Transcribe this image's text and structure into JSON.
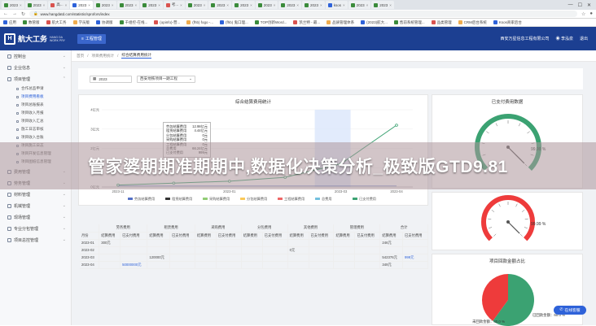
{
  "browser": {
    "tabs": [
      {
        "label": "2023",
        "color": "#3b8b3b",
        "active": false
      },
      {
        "label": "2023",
        "color": "#3b8b3b",
        "active": false
      },
      {
        "label": "高...",
        "color": "#d9534f",
        "active": false
      },
      {
        "label": "2023",
        "color": "#2e62d9",
        "active": true
      },
      {
        "label": "2023",
        "color": "#3b8b3b",
        "active": false
      },
      {
        "label": "2023",
        "color": "#3b8b3b",
        "active": false
      },
      {
        "label": "2023",
        "color": "#3b8b3b",
        "active": false
      },
      {
        "label": "考...",
        "color": "#d9534f",
        "active": false
      },
      {
        "label": "2023",
        "color": "#3b8b3b",
        "active": false
      },
      {
        "label": "2023",
        "color": "#3b8b3b",
        "active": false
      },
      {
        "label": "2023",
        "color": "#3b8b3b",
        "active": false
      },
      {
        "label": "2023",
        "color": "#3b8b3b",
        "active": false
      },
      {
        "label": "2023",
        "color": "#3b8b3b",
        "active": false
      },
      {
        "label": "2023",
        "color": "#3b8b3b",
        "active": false
      },
      {
        "label": "ksos",
        "color": "#2e62d9",
        "active": false
      },
      {
        "label": "2023",
        "color": "#3b8b3b",
        "active": false
      },
      {
        "label": "2023",
        "color": "#3b8b3b",
        "active": false
      }
    ],
    "url": "www.hangdatd.com/statistic/sprofors/index",
    "bookmarks": [
      "应用",
      "数管版",
      "航大工务",
      "学员版",
      "协调版",
      "千组控-在线...",
      "(opinfo)-营...",
      "(fhb) fogo -...",
      "(fhb) 鬼口理...",
      "TOP创新Word...",
      "凯兰特 - 最...",
      "品质管理体系",
      "(2023)航大...",
      "售前系统管理...",
      "品类管理",
      "CRM后台系统",
      "Ksos商家后台"
    ]
  },
  "app": {
    "logo_text": "航大工务",
    "logo_sub_1": "HANG DA",
    "logo_sub_2": "WORK PRY",
    "menu_label": "工程管理",
    "company": "西安万星信息工程有限公司",
    "user": "李泓泉",
    "logout": "退出"
  },
  "sidebar": {
    "items": [
      {
        "label": "控制台"
      },
      {
        "label": "企业信息"
      },
      {
        "label": "项目管理"
      }
    ],
    "subitems": [
      {
        "label": "合作总监申请",
        "active": false
      },
      {
        "label": "项目费用看板",
        "active": true
      },
      {
        "label": "项目总账报表",
        "active": false
      },
      {
        "label": "项目收入月报",
        "active": false
      },
      {
        "label": "项目收入汇总",
        "active": false
      },
      {
        "label": "施工日志审核",
        "active": false
      },
      {
        "label": "项目收入台账",
        "active": false
      },
      {
        "label": "项目施工日志",
        "active": false
      },
      {
        "label": "项目开发信息管理",
        "active": false
      },
      {
        "label": "项目图纸信息管理",
        "active": false
      }
    ],
    "bottom_items": [
      {
        "label": "费用管理"
      },
      {
        "label": "劳务管理"
      },
      {
        "label": "材料管理"
      },
      {
        "label": "机械管理"
      },
      {
        "label": "现场管理"
      },
      {
        "label": "专业分包管理"
      },
      {
        "label": "项目总控管理"
      }
    ]
  },
  "breadcrumb": [
    "首页",
    "项目费用统计",
    "综合结算费用统计"
  ],
  "filter": {
    "year": "2023",
    "project_placeholder": "西安地铁项目一期工程"
  },
  "line_chart": {
    "title": "综合结算费用统计",
    "y_ticks": [
      "4亿元",
      "3亿元",
      "2亿元",
      "1亿元",
      "0亿元"
    ],
    "legend": [
      "劳务结算费用",
      "租赁结算费用",
      "采购结算费用",
      "分包结算费用",
      "工程结算费用",
      "总费用",
      "已支付费用"
    ],
    "legend_colors": [
      "#5470c6",
      "#333333",
      "#91cc75",
      "#fac858",
      "#ee6666",
      "#73c0de",
      "#3ba272"
    ],
    "chart_data": {
      "type": "line",
      "x": [
        "2023-11",
        "2023-12",
        "2023-01",
        "2023-02",
        "2023-03",
        "2023-04"
      ],
      "series": [
        {
          "name": "总费用",
          "values": [
            0.1,
            0.2,
            0.3,
            0.5,
            1.2,
            3.2
          ]
        }
      ],
      "ylim": [
        0,
        4
      ]
    }
  },
  "tooltip": {
    "rows": [
      {
        "label": "劳务结算费用",
        "value": "12.98亿元"
      },
      {
        "label": "租赁结算费用",
        "value": "4.44亿元"
      },
      {
        "label": "分包结算费用",
        "value": "0元"
      },
      {
        "label": "采购结算费用",
        "value": "0元"
      },
      {
        "label": "工程结算费用",
        "value": "0元"
      },
      {
        "label": "总费用",
        "value": "66.24亿元"
      },
      {
        "label": "已支付费用",
        "value": "999元"
      }
    ]
  },
  "table": {
    "group_headers": [
      "",
      "劳务费用",
      "租赁费用",
      "采购费用",
      "分包费用",
      "其他费用",
      "管理费用",
      "合计"
    ],
    "sub_headers": [
      "月份",
      "结算费用",
      "已支付费用",
      "结算费用",
      "已支付费用",
      "结算费用",
      "已支付费用",
      "结算费用",
      "已支付费用",
      "结算费用",
      "已支付费用",
      "结算费用",
      "已支付费用",
      "结算费用",
      "已支付费用"
    ],
    "rows": [
      [
        "2023-01",
        "300元",
        "",
        "",
        "",
        "",
        "",
        "",
        "",
        "",
        "",
        "",
        "",
        "246元",
        ""
      ],
      [
        "2023-02",
        "",
        "",
        "",
        "",
        "",
        "",
        "",
        "",
        "0元",
        "",
        "",
        "",
        "",
        ""
      ],
      [
        "2023-03",
        "",
        "",
        "120000元",
        "",
        "",
        "",
        "",
        "",
        "",
        "",
        "",
        "",
        "542376元",
        "999元"
      ],
      [
        "2023-04",
        "",
        "50000000元",
        "",
        "",
        "",
        "",
        "",
        "",
        "",
        "",
        "",
        "",
        "349元",
        ""
      ]
    ]
  },
  "gauges": [
    {
      "title": "已支付费用数据",
      "value_label": "99.99 %",
      "value": 99.99,
      "color": "#3ba272"
    },
    {
      "title": "已支付费用数据",
      "value_label": "99.99 %",
      "value": 99.99,
      "color": "#ee3b3b"
    }
  ],
  "pie": {
    "title": "项目回款金额占比",
    "chart_data": {
      "type": "pie",
      "labels": [
        "已回款金额",
        "未回款金额"
      ],
      "values": [
        60,
        40
      ],
      "colors": [
        "#3ba272",
        "#ee3b3b"
      ]
    },
    "label_received": "已回款金额：60.0 %",
    "label_unreceived": "未回款金额：40.0 %"
  },
  "overlay_text": "管家婆期期准期期中,数据化决策分析_极致版GTD9.81",
  "help_button": "在线客服"
}
